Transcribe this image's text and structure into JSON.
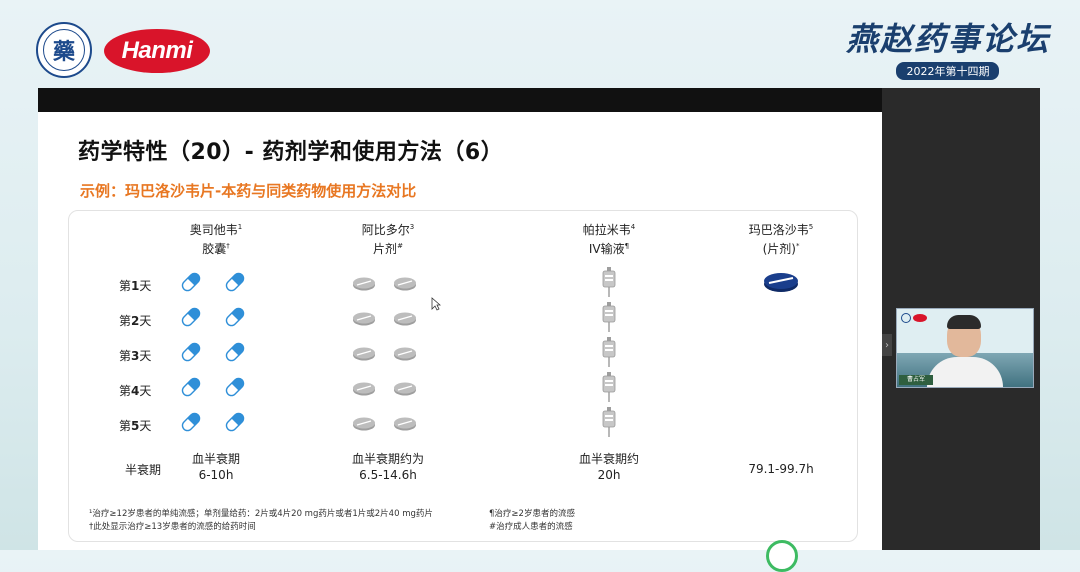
{
  "branding": {
    "assoc_logo_glyph": "藥",
    "hanmi_logo": "Hanmi",
    "forum_title": "燕赵药事论坛",
    "forum_subtitle": "2022年第十四期"
  },
  "slide": {
    "title": "药学特性（20）- 药剂学和使用方法（6）",
    "subtitle": "示例：玛巴洛沙韦片-本药与同类药物使用方法对比",
    "columns": [
      {
        "name": "奥司他韦",
        "sup1": "1",
        "form": "胶囊",
        "sup2": "†",
        "icon": "capsule-icon",
        "count": 2,
        "days": 5
      },
      {
        "name": "阿比多尔",
        "sup1": "3",
        "form": "片剂",
        "sup2": "#",
        "icon": "tablet-icon",
        "count": 2,
        "days": 5
      },
      {
        "name": "帕拉米韦",
        "sup1": "4",
        "form": "IV输液",
        "sup2": "¶",
        "icon": "iv-bag-icon",
        "count": 1,
        "days": 5
      },
      {
        "name": "玛巴洛沙韦",
        "sup1": "5",
        "form": "(片剂)",
        "sup2": "*",
        "icon": "tablet-single-icon",
        "count": 1,
        "days": 1
      }
    ],
    "rows": [
      {
        "prefix": "第",
        "num": "1",
        "suffix": "天"
      },
      {
        "prefix": "第",
        "num": "2",
        "suffix": "天"
      },
      {
        "prefix": "第",
        "num": "3",
        "suffix": "天"
      },
      {
        "prefix": "第",
        "num": "4",
        "suffix": "天"
      },
      {
        "prefix": "第",
        "num": "5",
        "suffix": "天"
      }
    ],
    "half_life_label": "半衰期",
    "half_life": [
      {
        "line1": "血半衰期",
        "line2": "6-10h"
      },
      {
        "line1": "血半衰期约为",
        "line2": "6.5-14.6h"
      },
      {
        "line1": "血半衰期约",
        "line2": "20h"
      },
      {
        "line1": "",
        "line2": "79.1-99.7h"
      }
    ],
    "footnotes_left": [
      "¹治疗≥12岁患者的单纯流感；单剂量给药：2片或4片20 mg药片或者1片或2片40 mg药片",
      "†此处显示治疗≥13岁患者的流感的给药时间"
    ],
    "footnotes_right": [
      "¶治疗≥2岁患者的流感",
      "#治疗成人患者的流感"
    ]
  },
  "webcam": {
    "name_tag": "曹占军"
  },
  "colors": {
    "accent_orange": "#e87722",
    "capsule_blue": "#2f8fd8",
    "tablet_navy": "#1a3e8c",
    "tablet_gray": "#bdbdbd",
    "hanmi_red": "#d9142a"
  }
}
